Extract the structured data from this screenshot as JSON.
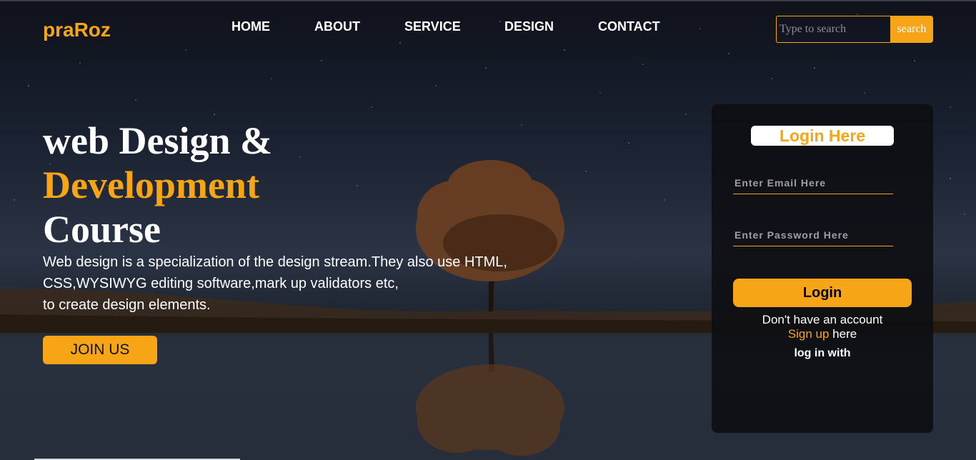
{
  "brand": {
    "logo": "praRoz",
    "accent_color": "#f5a516"
  },
  "nav": {
    "items": [
      "HOME",
      "ABOUT",
      "SERVICE",
      "DESIGN",
      "CONTACT"
    ]
  },
  "search": {
    "placeholder": "Type to search",
    "button_label": "search"
  },
  "hero": {
    "title_line1": "web Design &",
    "title_line2": "Development",
    "title_line3": "Course",
    "description_lines": [
      "Web design is a specialization of the design stream.They also use HTML,",
      "CSS,WYSIWYG editing software,mark up validators etc,",
      "to create design elements."
    ],
    "cta_label": "JOIN US"
  },
  "login": {
    "title": "Login Here",
    "email_placeholder": "Enter Email Here",
    "password_placeholder": "Enter Password Here",
    "button_label": "Login",
    "no_account_text": "Don't have an account",
    "signup_link": "Sign up",
    "signup_suffix": " here",
    "login_with_text": "log in with"
  },
  "background": {
    "scene": "night-sky-lone-tree-lake-reflection"
  }
}
